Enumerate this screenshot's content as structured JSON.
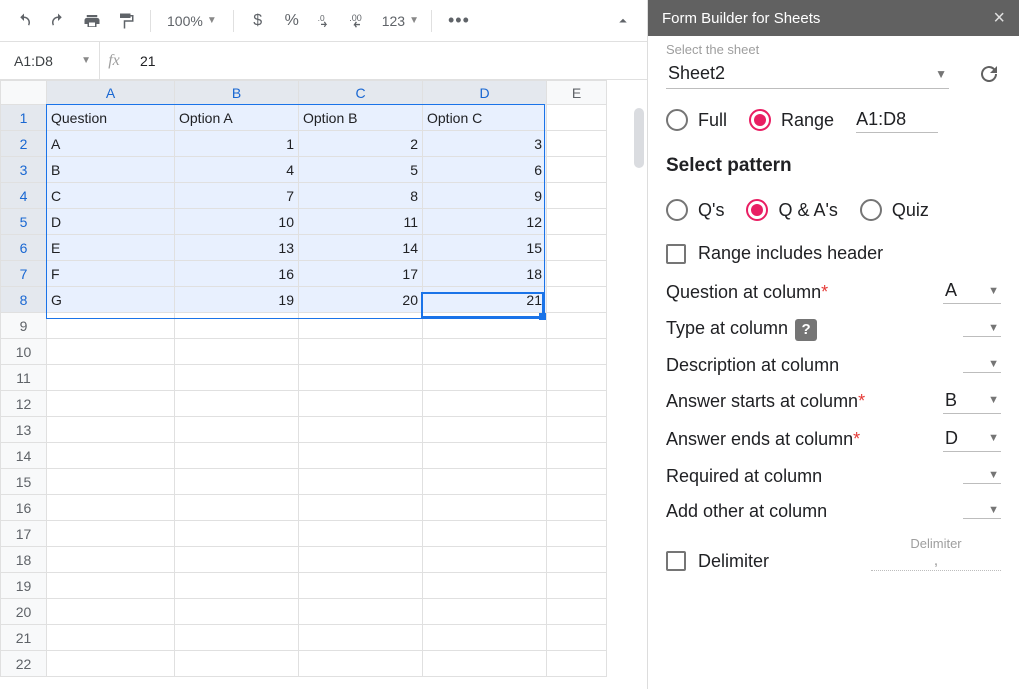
{
  "toolbar": {
    "zoom": "100%",
    "currency_symbol": "$",
    "percent_symbol": "%",
    "number_format": "123"
  },
  "formula_bar": {
    "name_box": "A1:D8",
    "value": "21"
  },
  "grid": {
    "cols": [
      "A",
      "B",
      "C",
      "D",
      "E"
    ],
    "rows": [
      1,
      2,
      3,
      4,
      5,
      6,
      7,
      8,
      9,
      10,
      11,
      12,
      13,
      14,
      15,
      16,
      17,
      18,
      19,
      20,
      21,
      22
    ],
    "data": [
      [
        "Question",
        "Option A",
        "Option B",
        "Option C",
        ""
      ],
      [
        "A",
        "1",
        "2",
        "3",
        ""
      ],
      [
        "B",
        "4",
        "5",
        "6",
        ""
      ],
      [
        "C",
        "7",
        "8",
        "9",
        ""
      ],
      [
        "D",
        "10",
        "11",
        "12",
        ""
      ],
      [
        "E",
        "13",
        "14",
        "15",
        ""
      ],
      [
        "F",
        "16",
        "17",
        "18",
        ""
      ],
      [
        "G",
        "19",
        "20",
        "21",
        ""
      ]
    ],
    "selection": {
      "r1": 1,
      "c1": 1,
      "r2": 8,
      "c2": 4
    },
    "active": {
      "r": 8,
      "c": 4
    }
  },
  "sidebar": {
    "title": "Form Builder for Sheets",
    "select_sheet_label": "Select the sheet",
    "sheet_value": "Sheet2",
    "mode": {
      "full": "Full",
      "range": "Range",
      "range_value": "A1:D8",
      "selected": "range"
    },
    "pattern_title": "Select pattern",
    "pattern": {
      "qs": "Q's",
      "qas": "Q & A's",
      "quiz": "Quiz",
      "selected": "qas"
    },
    "includes_header": "Range includes header",
    "fields": {
      "question_col": {
        "label": "Question at column",
        "value": "A",
        "required": true
      },
      "type_col": {
        "label": "Type at column",
        "value": "",
        "required": false,
        "help": true
      },
      "desc_col": {
        "label": "Description at column",
        "value": "",
        "required": false
      },
      "answer_start": {
        "label": "Answer starts at column",
        "value": "B",
        "required": true
      },
      "answer_end": {
        "label": "Answer ends at column",
        "value": "D",
        "required": true
      },
      "required_col": {
        "label": "Required at column",
        "value": "",
        "required": false
      },
      "add_other": {
        "label": "Add other at column",
        "value": "",
        "required": false
      }
    },
    "delimiter": {
      "header": "Delimiter",
      "label": "Delimiter",
      "value": ","
    }
  }
}
